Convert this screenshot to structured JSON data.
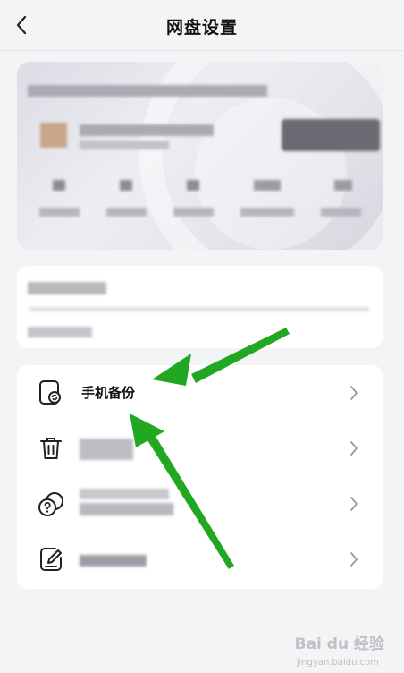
{
  "header": {
    "title": "网盘设置",
    "back_icon": "chevron-left-icon"
  },
  "menu": {
    "items": [
      {
        "label": "手机备份",
        "icon": "phone-backup-icon"
      },
      {
        "label": "",
        "icon": "trash-icon"
      },
      {
        "label": "",
        "icon": "help-coins-icon"
      },
      {
        "label": "",
        "icon": "edit-note-icon"
      }
    ]
  },
  "watermark": {
    "text": "Bai du 经验",
    "sub": "jingyan.baidu.com"
  },
  "colors": {
    "background": "#f3f4f6",
    "panel": "#ffffff",
    "annotation_arrow": "#22a722"
  }
}
